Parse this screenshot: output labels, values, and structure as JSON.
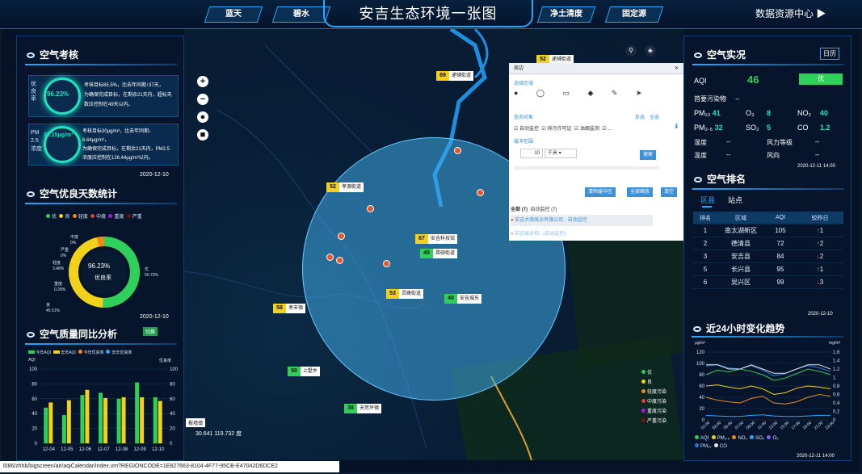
{
  "header": {
    "tabs": [
      "蓝天",
      "碧水",
      "净土清废",
      "固定源"
    ],
    "title": "安吉生态环境一张图",
    "right_label": "数据资源中心"
  },
  "left": {
    "kaohe": {
      "title": "空气考核",
      "card1_pct": "96.23%",
      "card1_caption": "优良率",
      "card1_text1": "考核目标85.5%，比去年同期↑37天，",
      "card1_text2": "为确保完成目标，在剩余21天内，超标天",
      "card1_text3": "数应控制在49天以内。",
      "card2_val": "26.15μg/m³",
      "card2_caption": "PM 2.5 浓度",
      "card2_text1": "考核目标30μg/m³，比去年同期↓",
      "card2_text2": "6.64μg/m³，",
      "card2_text3": "为确保完成目标，在剩余21天内，PM2.5",
      "card2_text4": "浓度应控制在126.44μg/m³以内。",
      "date": "2020-12-10"
    },
    "youliang": {
      "title": "空气优良天数统计",
      "legend": [
        "优",
        "良",
        "轻度",
        "中度",
        "重度",
        "严重"
      ],
      "legend_colors": [
        "#2fd05a",
        "#f2d11a",
        "#f08a1a",
        "#e53a3a",
        "#a11ad8",
        "#7b1010"
      ],
      "center_pct": "96.23%",
      "center_label": "优良率",
      "labels": {
        "zhongdu": "中度",
        "zhongdu_v": "0%",
        "yanzhong": "严重",
        "yanzhong_v": "0%",
        "qingdu": "轻度",
        "qingdu_v": "3.48%",
        "zhongdu2": "重度",
        "zhongdu2_v": "0.28%",
        "liang": "良",
        "liang_v": "45.51%",
        "you": "优",
        "you_v": "50.72%"
      },
      "date": "2020-12-10"
    },
    "tongbi": {
      "title": "空气质量同比分析",
      "switch": "切换",
      "legend": [
        "今年AQI",
        "去年AQI",
        "今年优良率",
        "去年优良率"
      ],
      "left_axis": "AQI",
      "right_axis": "优良率",
      "y_left": [
        "100",
        "80",
        "60",
        "40",
        "20",
        "0"
      ],
      "y_right": [
        "100",
        "80",
        "60",
        "40",
        "20",
        "0"
      ]
    }
  },
  "map": {
    "labels": [
      {
        "v": "52",
        "name": "递铺街道"
      },
      {
        "v": "69",
        "name": "递铺街道"
      },
      {
        "v": "52",
        "name": "孝源街道"
      },
      {
        "v": "67",
        "name": "安吉科技馆"
      },
      {
        "v": "45",
        "name": "昌硕街道"
      },
      {
        "v": "53",
        "name": "灵峰街道"
      },
      {
        "v": "40",
        "name": "安吉城东"
      },
      {
        "v": "58",
        "name": "孝丰镇"
      },
      {
        "v": "50",
        "name": "上墅乡"
      },
      {
        "v": "38",
        "name": "天荒坪镇"
      }
    ],
    "coords": "30.641  119.732 度",
    "left_bottom_tag": "报墙镇"
  },
  "popup": {
    "title": "周边",
    "section1": "选择区域",
    "section2": "查询对象",
    "opts": [
      "自动监控",
      "排污许可证",
      "油烟监测"
    ],
    "invert": "反选",
    "all": "全选",
    "buffer": "缓冲范围",
    "buffer_val": "10",
    "unit": "千米",
    "search_btn": "搜索",
    "btn_clear_center": "清除缓中区",
    "btn_all": "全部缩放",
    "btn_clear": "清空",
    "tab_all": "全部",
    "tab_all_n": "(7)",
    "tab_auto": "自动监控",
    "tab_auto_n": "(7)",
    "item1": "安吉大缘纸业有限公司 - 自动监控",
    "item2": "安吉县永和...(自动监控)"
  },
  "right": {
    "shikuang": {
      "title": "空气实况",
      "calendar": "日历",
      "aqi_label": "AQI",
      "aqi_val": "46",
      "level": "优",
      "primary_label": "首要污染物",
      "primary_val": "--",
      "pm10_label": "PM₁₀",
      "pm10_val": "41",
      "o3_label": "O₃",
      "o3_val": "8",
      "no2_label": "NO₂",
      "no2_val": "40",
      "pm25_label": "PM₂.₅",
      "pm25_val": "32",
      "so2_label": "SO₂",
      "so2_val": "5",
      "co_label": "CO",
      "co_val": "1.2",
      "humidity_label": "湿度",
      "humidity_val": "--",
      "wind_label": "风力等级",
      "wind_val": "--",
      "temp_label": "温度",
      "temp_val": "--",
      "winddir_label": "风向",
      "winddir_val": "--",
      "date": "2020-12-11 14:00"
    },
    "paiming": {
      "title": "空气排名",
      "tabs": [
        "区县",
        "站点"
      ],
      "headers": [
        "排名",
        "区域",
        "AQI",
        "较昨日"
      ],
      "rows": [
        {
          "rank": "1",
          "area": "南太湖新区",
          "aqi": "105",
          "chg": "1",
          "dir": "up"
        },
        {
          "rank": "2",
          "area": "德清县",
          "aqi": "72",
          "chg": "2",
          "dir": "up"
        },
        {
          "rank": "3",
          "area": "安吉县",
          "aqi": "84",
          "chg": "2",
          "dir": "dn"
        },
        {
          "rank": "5",
          "area": "长兴县",
          "aqi": "95",
          "chg": "1",
          "dir": "up"
        },
        {
          "rank": "6",
          "area": "吴兴区",
          "aqi": "99",
          "chg": "3",
          "dir": "dn"
        }
      ],
      "date": "2020-12-10"
    },
    "trend": {
      "title": "近24小时变化趋势",
      "unit_left": "μg/m³",
      "unit_right": "mg/m³",
      "y_left": [
        "120",
        "100",
        "80",
        "60",
        "40",
        "20",
        "0"
      ],
      "y_right": [
        "1.6",
        "1.4",
        "1.2",
        "1",
        "0.8",
        "0.6",
        "0.4",
        "0.2",
        "0"
      ],
      "legend": [
        "AQI",
        "PM₂.₅",
        "NO₂",
        "SO₂",
        "O₃",
        "PM₁₀",
        "CO"
      ],
      "legend_colors": [
        "#2fd05a",
        "#f2d11a",
        "#f08a1a",
        "#2aa7ff",
        "#8b5cf6",
        "#1e7ad8",
        "#e5e5e5"
      ],
      "date": "2020-12-11 14:00"
    }
  },
  "map_legend": [
    "优",
    "良",
    "轻度污染",
    "中度污染",
    "重度污染",
    "严重污染"
  ],
  "map_legend_colors": [
    "#2fd05a",
    "#f2d11a",
    "#f08a1a",
    "#e53a3a",
    "#a11ad8",
    "#7b1010"
  ],
  "statusbar": "l086/zhhb/bigscreen/air/aqiCalendar/index.vm?REGIONCODE=1E827663-8104-4F77-95CB-E47042D6DCE2",
  "chart_data": [
    {
      "type": "bar",
      "title": "空气质量同比分析",
      "categories": [
        "12-04",
        "12-05",
        "12-06",
        "12-07",
        "12-08",
        "12-09",
        "12-10"
      ],
      "series": [
        {
          "name": "今年AQI",
          "values": [
            48,
            38,
            65,
            68,
            60,
            82,
            62
          ]
        },
        {
          "name": "去年AQI",
          "values": [
            55,
            58,
            72,
            61,
            62,
            62,
            57
          ]
        }
      ],
      "ylim": [
        0,
        100
      ]
    },
    {
      "type": "line",
      "title": "近24小时变化趋势",
      "x": [
        "01:00",
        "03:00",
        "05:00",
        "07:00",
        "09:00",
        "11:00",
        "13:00",
        "15:00",
        "17:00",
        "19:00",
        "21:00",
        "23:00"
      ],
      "series": [
        {
          "name": "AQI",
          "values": [
            80,
            88,
            85,
            90,
            86,
            80,
            70,
            74,
            82,
            90,
            86,
            80
          ]
        },
        {
          "name": "PM₂.₅",
          "values": [
            60,
            62,
            58,
            55,
            60,
            55,
            45,
            48,
            56,
            60,
            58,
            55
          ]
        },
        {
          "name": "NO₂",
          "values": [
            40,
            35,
            32,
            30,
            38,
            42,
            30,
            28,
            32,
            40,
            45,
            42
          ]
        },
        {
          "name": "SO₂",
          "values": [
            8,
            7,
            6,
            6,
            8,
            9,
            7,
            6,
            6,
            7,
            8,
            8
          ]
        },
        {
          "name": "PM₁₀",
          "values": [
            95,
            98,
            92,
            90,
            96,
            88,
            78,
            82,
            90,
            96,
            92,
            86
          ]
        },
        {
          "name": "CO",
          "values": [
            1.3,
            1.3,
            1.2,
            1.2,
            1.3,
            1.2,
            1.1,
            1.1,
            1.2,
            1.3,
            1.3,
            1.2
          ]
        }
      ],
      "ylim": [
        0,
        120
      ]
    }
  ]
}
